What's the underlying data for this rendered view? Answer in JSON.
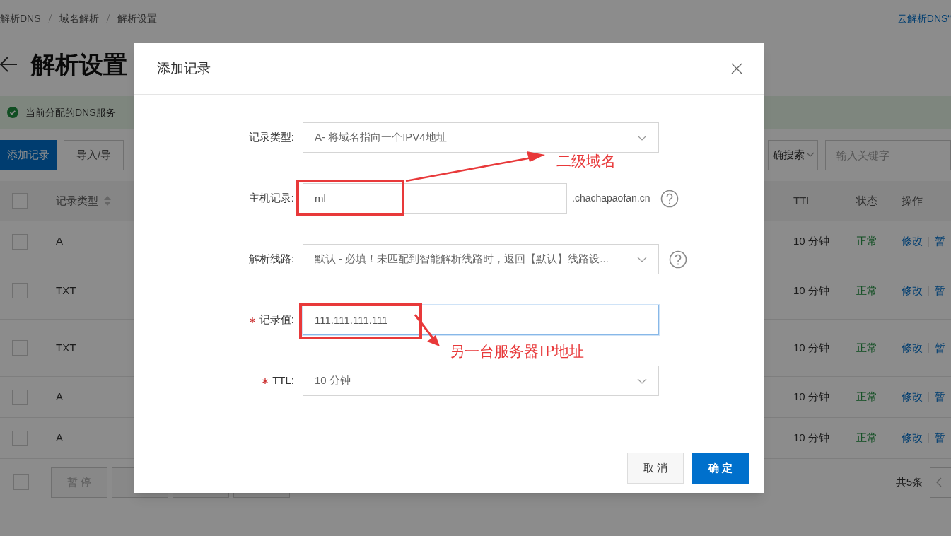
{
  "breadcrumb": [
    "解析DNS",
    "域名解析",
    "解析设置"
  ],
  "top_link": "云解析DNS“",
  "page_title": "解析设置",
  "alert": {
    "text": "当前分配的DNS服务"
  },
  "toolbar": {
    "buttons": [
      {
        "label": "添加记录",
        "primary": true
      },
      {
        "label": "导入/导",
        "primary": false
      }
    ],
    "search_mode": "确搜索",
    "search": {
      "placeholder": "输入关键字"
    }
  },
  "table": {
    "columns": [
      "记录类型",
      "TTL",
      "状态",
      "操作"
    ],
    "header_checked": false,
    "rows": [
      {
        "type": "A",
        "ttl": "10 分钟",
        "status": "正常",
        "actions": [
          "修改",
          "暂"
        ],
        "tall": false,
        "checked": false
      },
      {
        "type": "TXT",
        "ttl": "10 分钟",
        "status": "正常",
        "actions": [
          "修改",
          "暂"
        ],
        "tall": true,
        "checked": false
      },
      {
        "type": "TXT",
        "ttl": "10 分钟",
        "status": "正常",
        "actions": [
          "修改",
          "暂"
        ],
        "tall": true,
        "checked": false
      },
      {
        "type": "A",
        "ttl": "10 分钟",
        "status": "正常",
        "actions": [
          "修改",
          "暂"
        ],
        "tall": false,
        "checked": false
      },
      {
        "type": "A",
        "ttl": "10 分钟",
        "status": "正常",
        "actions": [
          "修改",
          "暂"
        ],
        "tall": false,
        "checked": false
      }
    ]
  },
  "footer": {
    "checked": false,
    "buttons": [
      {
        "label": "暂 停",
        "disabled": true
      },
      {
        "disabled": true
      },
      {
        "disabled": true
      },
      {
        "disabled": true
      }
    ],
    "total": "共5条"
  },
  "dialog": {
    "title": "添加记录",
    "fields": [
      {
        "kind": "select",
        "label": "记录类型:",
        "required": false,
        "value": "A- 将域名指向一个IPV4地址",
        "help": false
      },
      {
        "kind": "input",
        "label": "主机记录:",
        "required": false,
        "value": "ml",
        "suffix": ".chachapaofan.cn",
        "help": true,
        "focused": false
      },
      {
        "kind": "select",
        "label": "解析线路:",
        "required": false,
        "value": "默认 - 必填！未匹配到智能解析线路时，返回【默认】线路设...",
        "help": true
      },
      {
        "kind": "input",
        "label": "记录值:",
        "required": true,
        "value": "111.111.111.111",
        "help": false,
        "focused": true
      },
      {
        "kind": "select",
        "label": "TTL:",
        "required": true,
        "value": "10 分钟",
        "help": false
      }
    ],
    "buttons": [
      {
        "label": "取 消",
        "primary": false
      },
      {
        "label": "确 定",
        "primary": true
      }
    ]
  },
  "annotations": [
    "二级域名",
    "另一台服务器IP地址"
  ]
}
